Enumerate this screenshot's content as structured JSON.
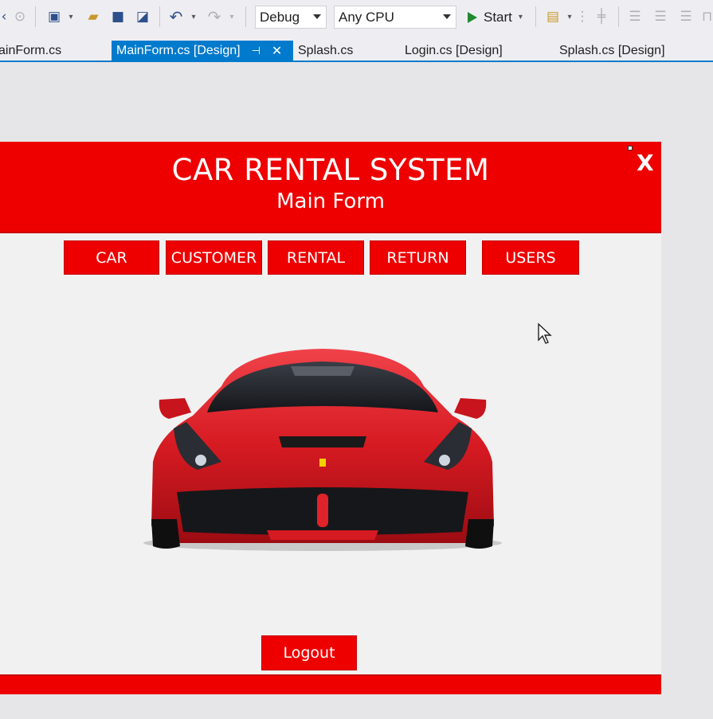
{
  "toolbar": {
    "config_value": "Debug",
    "platform_value": "Any CPU",
    "start_label": "Start"
  },
  "tabs": [
    {
      "label": "ainForm.cs"
    },
    {
      "label": "MainForm.cs [Design]",
      "active": true
    },
    {
      "label": "Splash.cs"
    },
    {
      "label": "Login.cs [Design]"
    },
    {
      "label": "Splash.cs [Design]"
    }
  ],
  "form": {
    "title": "CAR RENTAL SYSTEM",
    "subtitle": "Main Form",
    "close_label": "X",
    "nav_buttons": [
      "CAR",
      "CUSTOMER",
      "RENTAL",
      "RETURN",
      "USERS"
    ],
    "logout_label": "Logout"
  },
  "colors": {
    "brand_red": "#ee0000",
    "vs_accent": "#007acc"
  }
}
